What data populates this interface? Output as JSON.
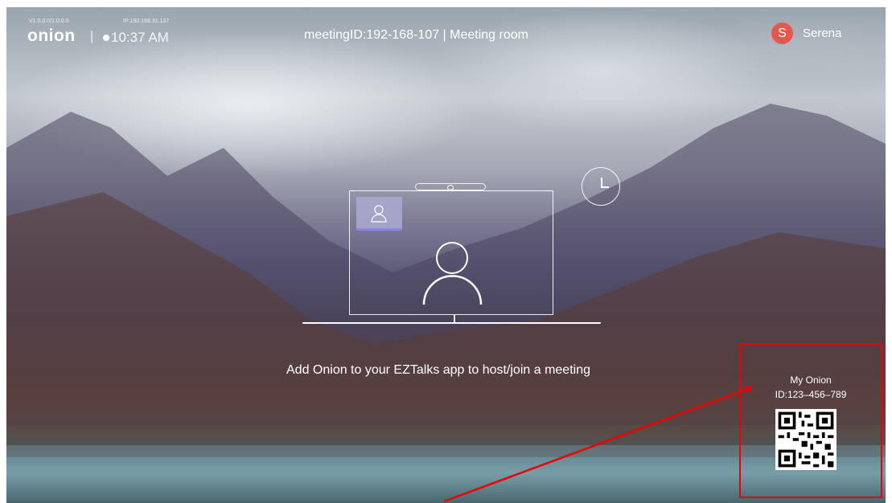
{
  "top_bar": {
    "version": "V1.0.0.0/1.0.0.0",
    "ip": "IP:192.168.31.137",
    "logo": "onion",
    "separator": "|",
    "time": "10:37 AM",
    "meeting_title": "meetingID:192-168-107 | Meeting room",
    "user_initial": "S",
    "user_name": "Serena"
  },
  "main": {
    "prompt": "Add Onion to your EZTalks app to host/join a meeting"
  },
  "qr_panel": {
    "title": "My Onion",
    "id": "ID:123–456–789"
  },
  "icons": [
    "clock-icon",
    "camera-icon",
    "user-icon",
    "qr-code-icon"
  ],
  "colors": {
    "avatar": "#e8574f",
    "annotation": "#ee0000",
    "pip_bar": "#8a86e8"
  }
}
